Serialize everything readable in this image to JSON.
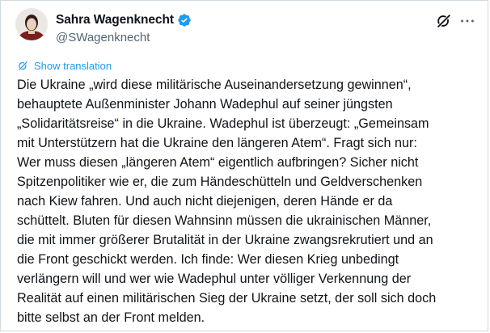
{
  "author": {
    "display_name": "Sahra Wagenknecht",
    "handle": "@SWagenknecht"
  },
  "actions": {
    "translate_label": "Show translation"
  },
  "tweet": {
    "lines": [
      "Die Ukraine „wird diese militärische Auseinandersetzung gewinnen“,",
      "behauptete Außenminister Johann Wadephul auf seiner jüngsten",
      "„Solidaritätsreise“ in die Ukraine. Wadephul ist überzeugt: „Gemeinsam",
      "mit Unterstützern hat die Ukraine den längeren Atem“. Fragt sich nur:",
      "Wer muss diesen „längeren Atem“ eigentlich aufbringen? Sicher nicht",
      "Spitzenpolitiker wie er, die zum Händeschütteln und Geldverschenken",
      "nach Kiew fahren. Und auch nicht diejenigen, deren Hände er da",
      "schüttelt. Bluten für diesen Wahnsinn müssen die ukrainischen Männer,",
      "die mit immer größerer Brutalität in der Ukraine zwangsrekrutiert und an",
      "die Front geschickt werden. Ich finde: Wer diesen Krieg unbedingt",
      "verlängern will und wer wie Wadephul unter völliger Verkennung der",
      "Realität auf einen militärischen Sieg der Ukraine setzt, der soll sich doch",
      "bitte selbst an der Front melden."
    ]
  },
  "colors": {
    "link": "#1d9bf0",
    "verified": "#1d9bf0",
    "secondary_text": "#536471",
    "primary_text": "#0f1419"
  },
  "icons": [
    "verified-badge-icon",
    "grok-icon",
    "more-icon",
    "translate-icon"
  ]
}
